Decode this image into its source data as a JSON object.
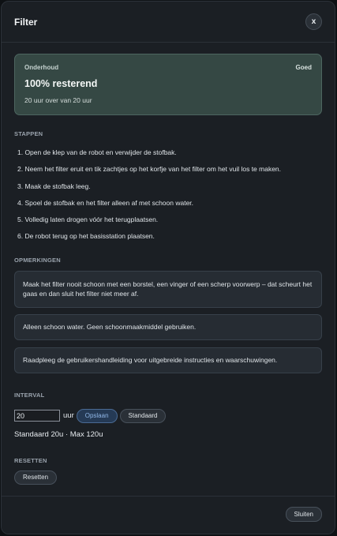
{
  "dialog": {
    "title": "Filter",
    "close_label": "x"
  },
  "status": {
    "label": "Onderhoud",
    "badge": "Goed",
    "percentage_text": "100% resterend",
    "hours_text": "20 uur over van 20 uur",
    "accent_color": "#354844"
  },
  "steps": {
    "title": "STAPPEN",
    "items": [
      "1. Open de klep van de robot en verwijder de stofbak.",
      "2. Neem het filter eruit en tik zachtjes op het korfje van het filter om het vuil los te maken.",
      "3. Maak de stofbak leeg.",
      "4. Spoel de stofbak en het filter alleen af met schoon water.",
      "5. Volledig laten drogen vóór het terugplaatsen.",
      "6. De robot terug op het basisstation plaatsen."
    ]
  },
  "notes": {
    "title": "OPMERKINGEN",
    "items": [
      "Maak het filter nooit schoon met een borstel, een vinger of een scherp voorwerp – dat scheurt het gaas en dan sluit het filter niet meer af.",
      "Alleen schoon water. Geen schoonmaakmiddel gebruiken.",
      "Raadpleeg de gebruikershandleiding voor uitgebreide instructies en waarschuwingen."
    ]
  },
  "interval": {
    "title": "INTERVAL",
    "value": "20",
    "unit": "uur",
    "save_label": "Opslaan",
    "default_label": "Standaard",
    "range_text": "Standaard 20u · Max 120u"
  },
  "reset": {
    "title": "RESETTEN",
    "button_label": "Resetten"
  },
  "footer": {
    "close_label": "Sluiten"
  }
}
